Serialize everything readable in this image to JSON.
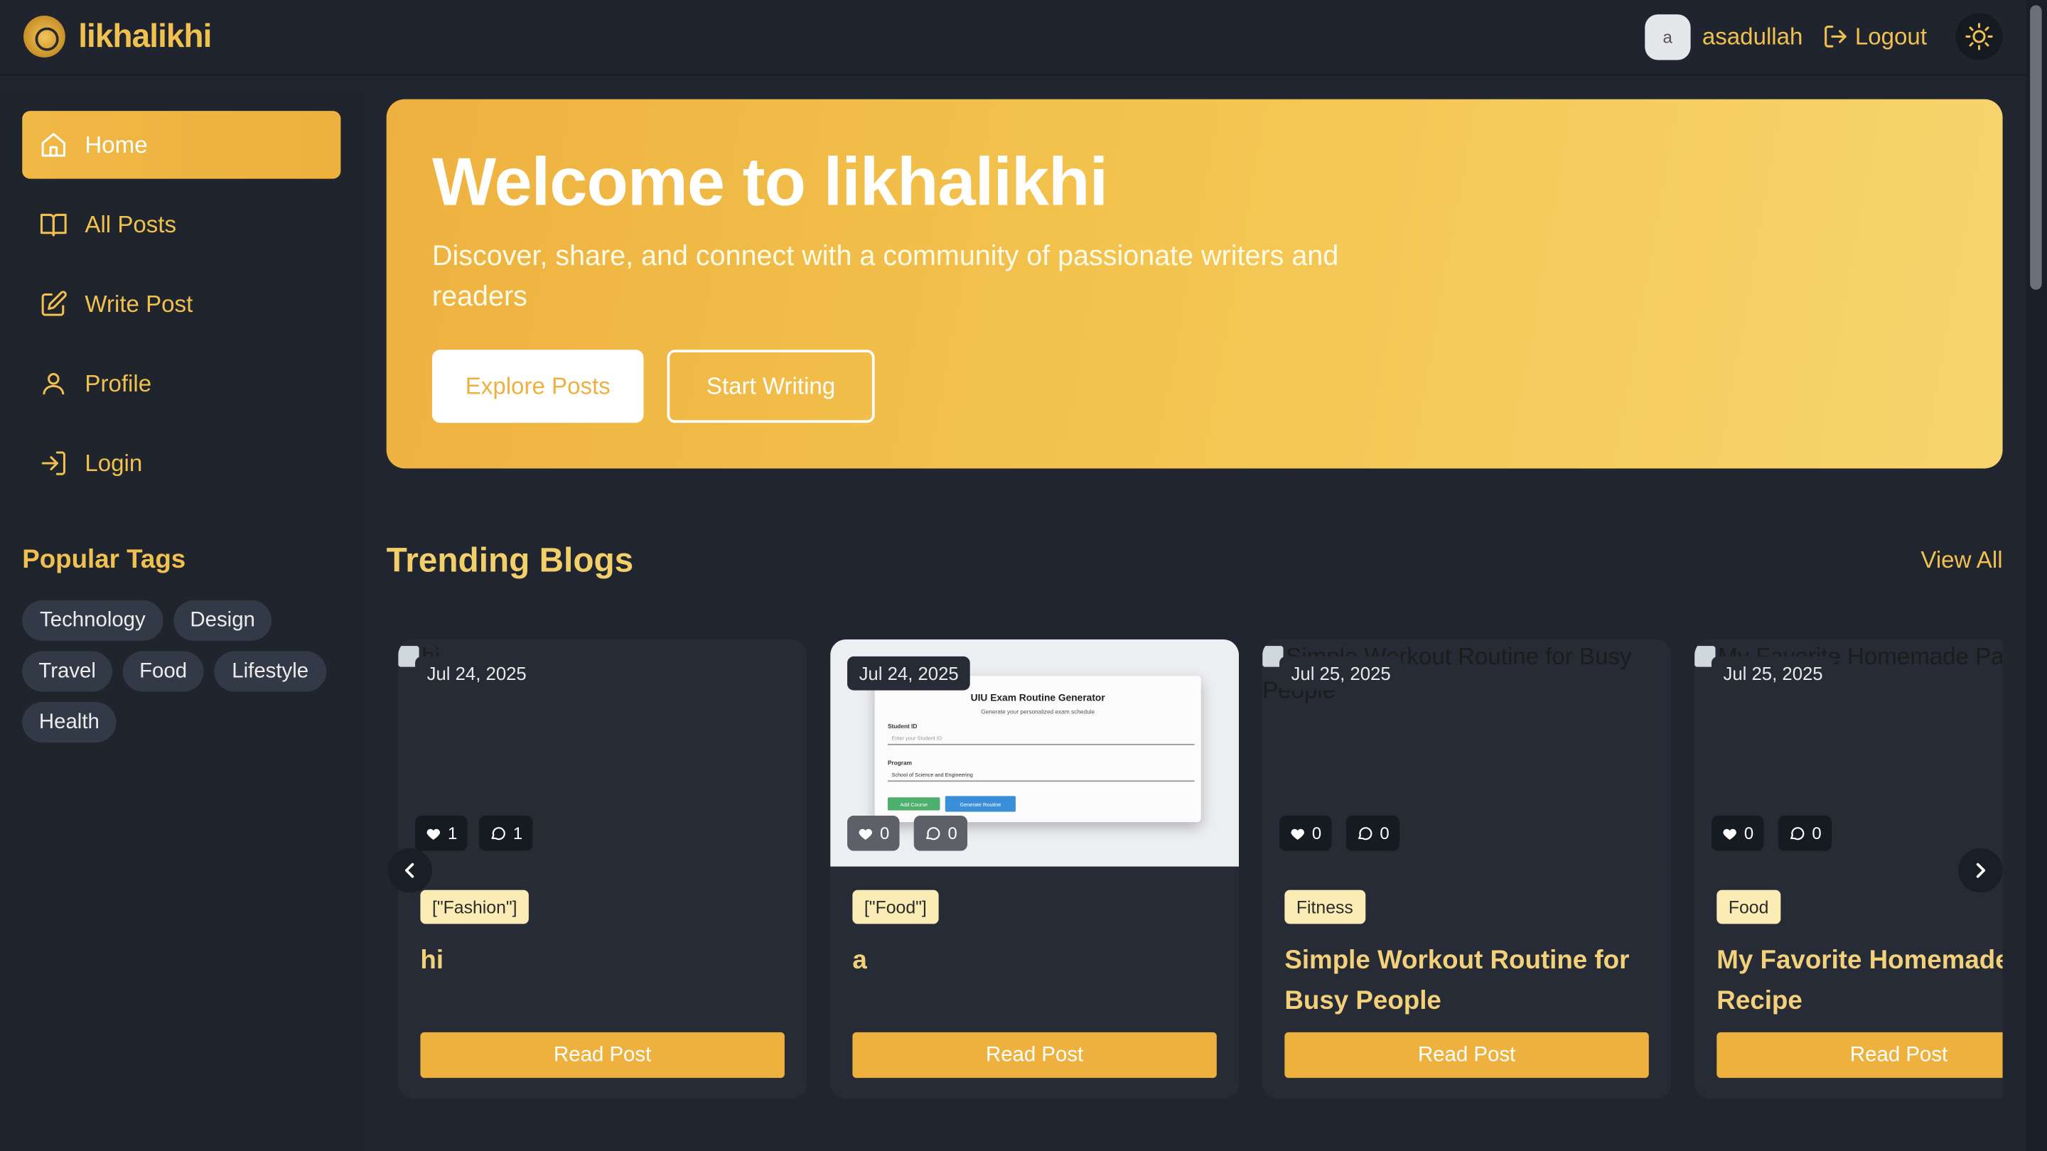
{
  "app": {
    "brand": "likhalikhi"
  },
  "user": {
    "avatar_letter": "a",
    "name": "asadullah",
    "logout_label": "Logout"
  },
  "sidebar": {
    "items": [
      {
        "label": "Home",
        "icon": "home-icon",
        "active": true
      },
      {
        "label": "All Posts",
        "icon": "book-icon",
        "active": false
      },
      {
        "label": "Write Post",
        "icon": "edit-icon",
        "active": false
      },
      {
        "label": "Profile",
        "icon": "user-icon",
        "active": false
      },
      {
        "label": "Login",
        "icon": "login-icon",
        "active": false
      }
    ],
    "tags_title": "Popular Tags",
    "tags": [
      "Technology",
      "Design",
      "Travel",
      "Food",
      "Lifestyle",
      "Health"
    ]
  },
  "hero": {
    "title": "Welcome to likhalikhi",
    "subtitle": "Discover, share, and connect with a community of passionate writers and readers",
    "explore_label": "Explore Posts",
    "start_label": "Start Writing"
  },
  "trending": {
    "title": "Trending Blogs",
    "view_all_label": "View All",
    "cards": [
      {
        "image_alt": "hi",
        "date": "Jul 24, 2025",
        "likes": "1",
        "comments": "1",
        "category": "[\"Fashion\"]",
        "title": "hi",
        "read_label": "Read Post"
      },
      {
        "image_alt": "",
        "date": "Jul 24, 2025",
        "likes": "0",
        "comments": "0",
        "category": "[\"Food\"]",
        "title": "a",
        "read_label": "Read Post",
        "screenshot": {
          "heading": "UIU Exam Routine Generator",
          "sub": "Generate your personalized exam schedule",
          "student_label": "Student ID",
          "student_placeholder": "Enter your Student ID",
          "program_label": "Program",
          "program_value": "School of Science and Engineering",
          "add_label": "Add Course",
          "generate_label": "Generate Routine"
        }
      },
      {
        "image_alt": "Simple Workout Routine for Busy People",
        "date": "Jul 25, 2025",
        "likes": "0",
        "comments": "0",
        "category": "Fitness",
        "title": "Simple Workout Routine for Busy People",
        "read_label": "Read Post"
      },
      {
        "image_alt": "My Favorite Homemade Pasta",
        "date": "Jul 25, 2025",
        "likes": "0",
        "comments": "0",
        "category": "Food",
        "title": "My Favorite Homemade Recipe",
        "read_label": "Read Post"
      }
    ]
  },
  "colors": {
    "accent": "#f0c14f",
    "hero_start": "#eeb13f",
    "hero_end": "#f7d56e",
    "background": "#202530",
    "card": "#262b35"
  }
}
